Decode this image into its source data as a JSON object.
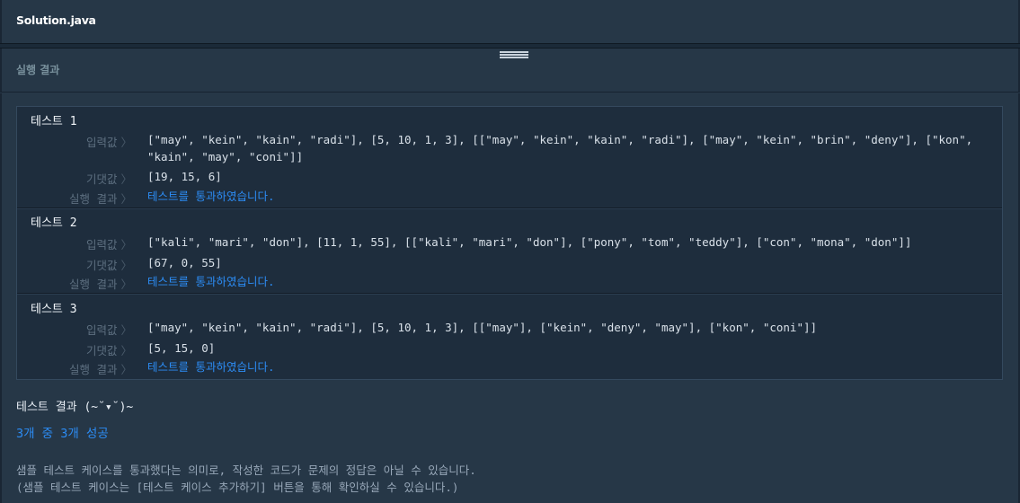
{
  "editor": {
    "file_tab": "Solution.java"
  },
  "result_panel": {
    "title": "실행 결과"
  },
  "labels": {
    "input": "입력값",
    "expected": "기댓값",
    "result": "실행 결과",
    "chevron": "〉"
  },
  "tests": [
    {
      "title": "테스트 1",
      "input": "[\"may\", \"kein\", \"kain\", \"radi\"], [5, 10, 1, 3], [[\"may\", \"kein\", \"kain\", \"radi\"], [\"may\", \"kein\", \"brin\", \"deny\"], [\"kon\", \"kain\", \"may\", \"coni\"]]",
      "expected": "[19, 15, 6]",
      "result": "테스트를 통과하였습니다."
    },
    {
      "title": "테스트 2",
      "input": "[\"kali\", \"mari\", \"don\"], [11, 1, 55], [[\"kali\", \"mari\", \"don\"], [\"pony\", \"tom\", \"teddy\"], [\"con\", \"mona\", \"don\"]]",
      "expected": "[67, 0, 55]",
      "result": "테스트를 통과하였습니다."
    },
    {
      "title": "테스트 3",
      "input": "[\"may\", \"kein\", \"kain\", \"radi\"], [5, 10, 1, 3], [[\"may\"], [\"kein\", \"deny\", \"may\"], [\"kon\", \"coni\"]]",
      "expected": "[5, 15, 0]",
      "result": "테스트를 통과하였습니다."
    }
  ],
  "summary": {
    "title": "테스트 결과 (~˘▾˘)~",
    "result": "3개 중 3개 성공",
    "note_line1": "샘플 테스트 케이스를 통과했다는 의미로, 작성한 코드가 문제의 정답은 아닐 수 있습니다.",
    "note_line2": "(샘플 테스트 케이스는 [테스트 케이스 추가하기] 버튼을 통해 확인하실 수 있습니다.)"
  },
  "colors": {
    "background": "#263747",
    "panel": "#1e2d3d",
    "pass": "#2c8cf4"
  }
}
